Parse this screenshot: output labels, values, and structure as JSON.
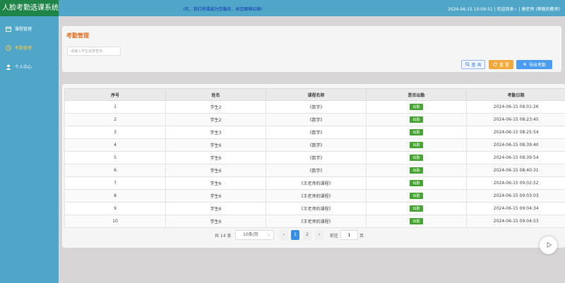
{
  "app": {
    "title": "人脸考勤选课系统"
  },
  "header": {
    "marquee": "!欢，我们将竭诚为您服务，祝您哪顺拉顺!",
    "user_info": "2024-06-15 10:09:51 | 欢迎回来~ | 唐老师 (尊敬的教师)"
  },
  "sidebar": {
    "items": [
      {
        "label": "课程管理",
        "icon": "calendar-icon"
      },
      {
        "label": "考勤管理",
        "icon": "clock-icon",
        "active": true
      },
      {
        "label": "个人中心",
        "icon": "user-icon"
      }
    ]
  },
  "page": {
    "title": "考勤管理"
  },
  "search": {
    "placeholder": "请输入学生名称查询"
  },
  "toolbar": {
    "query_label": "查 询",
    "reset_label": "重 置",
    "export_label": "导出考勤"
  },
  "table": {
    "columns": [
      "序号",
      "姓名",
      "课程名称",
      "是否出勤",
      "考勤日期"
    ],
    "rows": [
      {
        "no": "1",
        "name": "学生2",
        "course": "《数学》",
        "status": "出勤",
        "date": "2024-06-15 08:01:26"
      },
      {
        "no": "2",
        "name": "学生2",
        "course": "《数学》",
        "status": "出勤",
        "date": "2024-06-15 08:23:45"
      },
      {
        "no": "3",
        "name": "学生3",
        "course": "《数学》",
        "status": "出勤",
        "date": "2024-06-15 08:25:54"
      },
      {
        "no": "4",
        "name": "学生6",
        "course": "《数学》",
        "status": "出勤",
        "date": "2024-06-15 08:39:40"
      },
      {
        "no": "5",
        "name": "学生6",
        "course": "《数学》",
        "status": "出勤",
        "date": "2024-06-15 08:39:54"
      },
      {
        "no": "6",
        "name": "学生6",
        "course": "《数学》",
        "status": "出勤",
        "date": "2024-06-15 08:40:31"
      },
      {
        "no": "7",
        "name": "学生6",
        "course": "《王老师的课程》",
        "status": "出勤",
        "date": "2024-06-15 09:02:52"
      },
      {
        "no": "8",
        "name": "学生6",
        "course": "《王老师的课程》",
        "status": "出勤",
        "date": "2024-06-15 09:03:03"
      },
      {
        "no": "9",
        "name": "学生6",
        "course": "《王老师的课程》",
        "status": "出勤",
        "date": "2024-06-15 09:04:34"
      },
      {
        "no": "10",
        "name": "学生6",
        "course": "《王老师的课程》",
        "status": "出勤",
        "date": "2024-06-15 09:04:53"
      }
    ]
  },
  "pagination": {
    "total": "共 14 条",
    "page_size": "10条/页",
    "prev": "‹",
    "next": "›",
    "pages": [
      "1",
      "2"
    ],
    "goto_label": "前往",
    "goto_value": "1",
    "goto_unit": "页"
  },
  "colors": {
    "sidebar": "#4fa6c8",
    "logo_bg": "#1e8447",
    "title_accent": "#e46c1e",
    "status_tag": "#46a432",
    "primary": "#4a9cf0",
    "warning": "#f0a93a"
  }
}
